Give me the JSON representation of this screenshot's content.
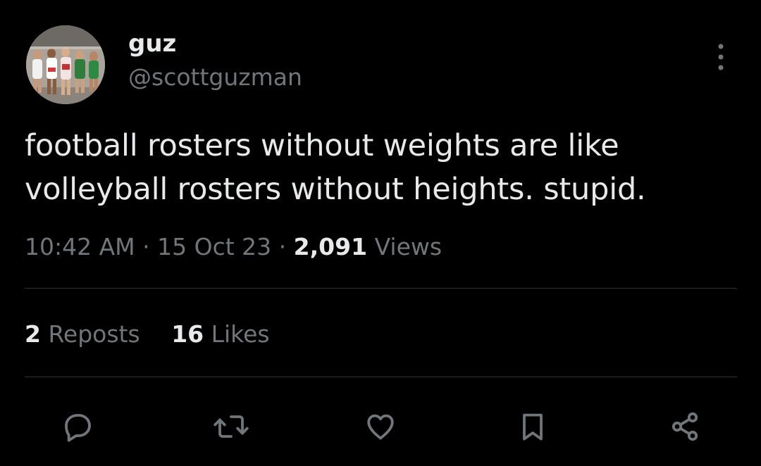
{
  "user": {
    "display_name": "guz",
    "handle": "@scottguzman",
    "avatar_icon": "avatar-photo"
  },
  "tweet": {
    "text": "football rosters without weights are like volleyball rosters without heights. stupid.",
    "time": "10:42 AM",
    "separator": "·",
    "date": "15 Oct 23",
    "views_count": "2,091",
    "views_label": "Views"
  },
  "stats": {
    "reposts_count": "2",
    "reposts_label": "Reposts",
    "likes_count": "16",
    "likes_label": "Likes"
  },
  "actions": [
    {
      "name": "reply",
      "icon": "reply-icon"
    },
    {
      "name": "repost",
      "icon": "repost-icon"
    },
    {
      "name": "like",
      "icon": "heart-icon"
    },
    {
      "name": "bookmark",
      "icon": "bookmark-icon"
    },
    {
      "name": "share",
      "icon": "share-icon"
    }
  ],
  "colors": {
    "background": "#000000",
    "text_primary": "#e7e9ea",
    "text_secondary": "#71767b",
    "divider": "#2f3336"
  }
}
